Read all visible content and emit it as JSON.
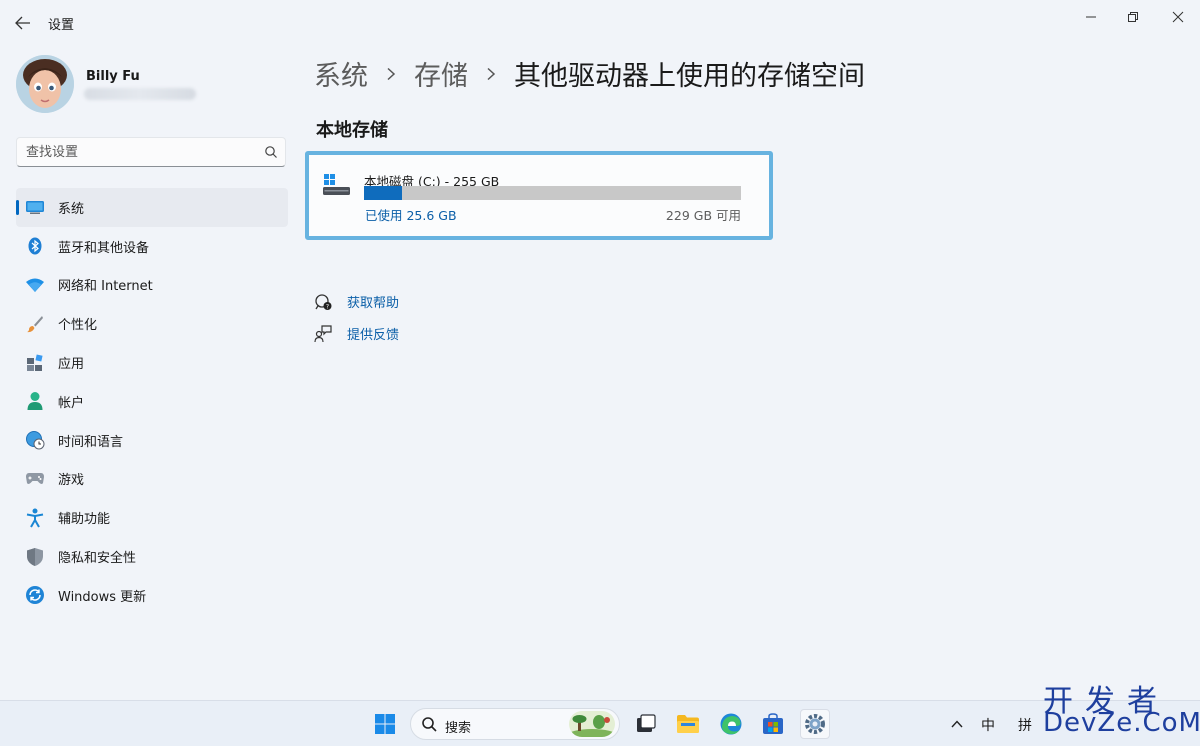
{
  "window": {
    "title": "设置"
  },
  "profile": {
    "name": "Billy Fu"
  },
  "search": {
    "placeholder": "查找设置"
  },
  "sidebar": {
    "items": [
      {
        "label": "系统",
        "icon": "system-icon",
        "active": true
      },
      {
        "label": "蓝牙和其他设备",
        "icon": "bluetooth-icon"
      },
      {
        "label": "网络和 Internet",
        "icon": "wifi-icon"
      },
      {
        "label": "个性化",
        "icon": "brush-icon"
      },
      {
        "label": "应用",
        "icon": "apps-icon"
      },
      {
        "label": "帐户",
        "icon": "account-icon"
      },
      {
        "label": "时间和语言",
        "icon": "globe-clock-icon"
      },
      {
        "label": "游戏",
        "icon": "gamepad-icon"
      },
      {
        "label": "辅助功能",
        "icon": "accessibility-icon"
      },
      {
        "label": "隐私和安全性",
        "icon": "shield-icon"
      },
      {
        "label": "Windows 更新",
        "icon": "update-icon"
      }
    ]
  },
  "breadcrumb": {
    "part1": "系统",
    "part2": "存储",
    "current": "其他驱动器上使用的存储空间"
  },
  "main": {
    "section_title": "本地存储",
    "drive": {
      "name": "本地磁盘 (C:) - 255 GB",
      "used_label": "已使用 25.6 GB",
      "free_label": "229 GB 可用",
      "used_fraction": 0.1
    },
    "links": {
      "help": "获取帮助",
      "feedback": "提供反馈"
    }
  },
  "taskbar": {
    "search_label": "搜索",
    "tray_ime1": "中",
    "tray_ime2": "拼"
  },
  "watermark": {
    "line1": "开发者",
    "line2": "DevZe.CoM"
  },
  "colors": {
    "accent": "#0067c0",
    "card_focus": "#67b3e0",
    "bar_fill": "#0f6cbd"
  }
}
